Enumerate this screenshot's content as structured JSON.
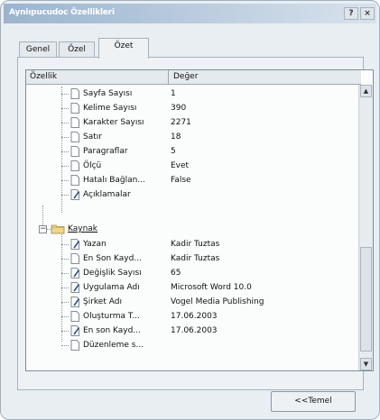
{
  "window": {
    "title": "Ayniıpucudoc Özellikleri",
    "help_label": "?",
    "close_label": "×"
  },
  "tabs": [
    {
      "label": "Genel"
    },
    {
      "label": "Özel"
    },
    {
      "label": "Özet"
    }
  ],
  "columns": {
    "property": "Özellik",
    "value": "Değer"
  },
  "group_a": [
    {
      "name": "Sayfa Sayısı",
      "value": "1",
      "icon": "doc-icon"
    },
    {
      "name": "Kelime Sayısı",
      "value": "390",
      "icon": "doc-icon"
    },
    {
      "name": "Karakter Sayısı",
      "value": "2271",
      "icon": "doc-icon"
    },
    {
      "name": "Satır",
      "value": "18",
      "icon": "doc-icon"
    },
    {
      "name": "Paragraflar",
      "value": "5",
      "icon": "doc-icon"
    },
    {
      "name": "Ölçü",
      "value": "Evet",
      "icon": "doc-icon"
    },
    {
      "name": "Hatalı Bağlan...",
      "value": "False",
      "icon": "doc-icon"
    },
    {
      "name": "Açıklamalar",
      "value": "",
      "icon": "edit-icon"
    }
  ],
  "group_b_label": "Kaynak",
  "group_b": [
    {
      "name": "Yazan",
      "value": "Kadir Tuztas",
      "icon": "edit-icon"
    },
    {
      "name": "En Son Kayd...",
      "value": "Kadir Tuztas",
      "icon": "doc-icon"
    },
    {
      "name": "Değişlik Sayısı",
      "value": "65",
      "icon": "edit-icon"
    },
    {
      "name": "Uygulama Adı",
      "value": "Microsoft Word 10.0",
      "icon": "edit-icon"
    },
    {
      "name": "Şirket Adı",
      "value": "Vogel Media Publishing",
      "icon": "edit-icon"
    },
    {
      "name": "Oluşturma T...",
      "value": "17.06.2003",
      "icon": "doc-icon"
    },
    {
      "name": "En son Kayd...",
      "value": "17.06.2003",
      "icon": "edit-icon"
    },
    {
      "name": "Düzenleme s...",
      "value": "",
      "icon": "doc-icon"
    }
  ],
  "buttons": {
    "back": "<<Temel"
  }
}
